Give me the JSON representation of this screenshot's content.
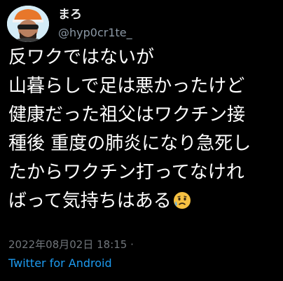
{
  "user": {
    "display_name": "まろ",
    "handle": "@hyp0cr1te_"
  },
  "tweet": {
    "lines": [
      "反ワクではないが",
      "山暮らしで足は悪かったけど",
      "健康だった祖父はワクチン接",
      "種後 重度の肺炎になり急死し",
      "たからワクチン打ってなけれ",
      "ばって気持ちはある"
    ],
    "emoji": "sad-sweat-face-emoji"
  },
  "meta": {
    "timestamp": "2022年08月02日 18:15 ·",
    "source": "Twitter for Android"
  },
  "colors": {
    "background": "#000000",
    "text": "#ffffff",
    "secondary": "#71767b",
    "link": "#1d9bf0"
  }
}
